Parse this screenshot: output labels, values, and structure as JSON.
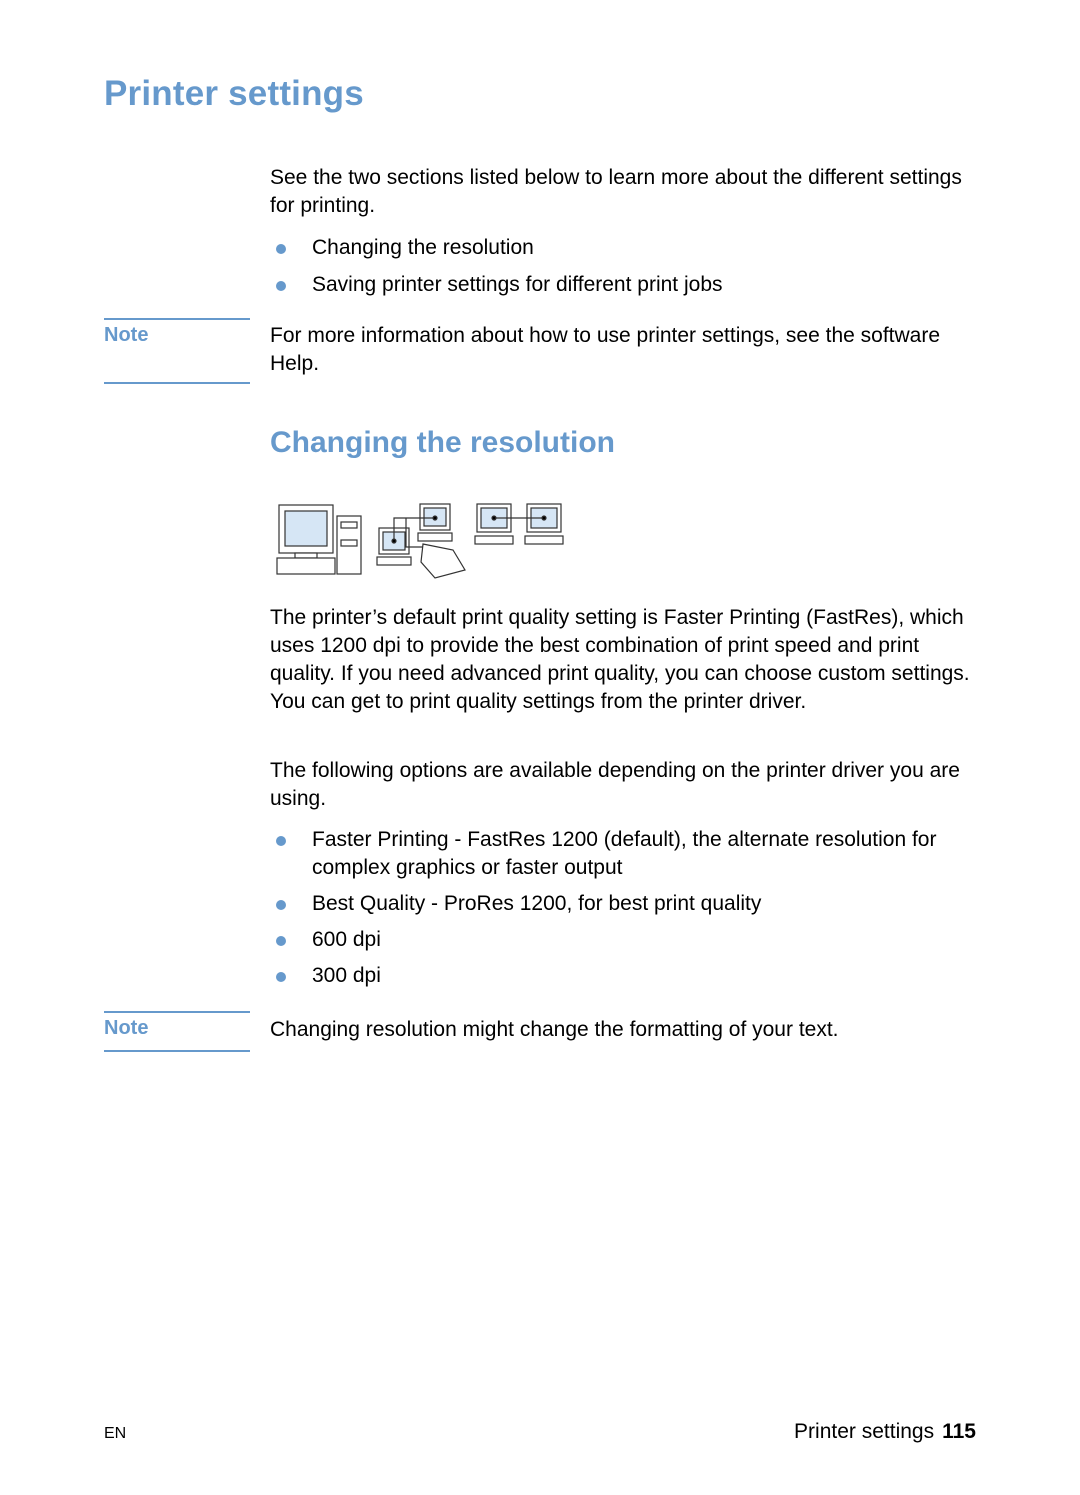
{
  "page_title": "Printer settings",
  "intro": {
    "text": "See the two sections listed below to learn more about the different settings for printing.",
    "bullets": [
      "Changing the resolution",
      "Saving printer settings for different print jobs"
    ]
  },
  "note1": {
    "label": "Note",
    "text": "For more information about how to use printer settings, see the software Help."
  },
  "section": {
    "title": "Changing the resolution",
    "illustration": "computer-network-printer-illustration",
    "paragraph1": "The printer’s default print quality setting is Faster Printing (FastRes), which uses 1200 dpi to provide the best combination of print speed and print quality. If you need advanced print quality, you can choose custom settings. You can get to print quality settings from the printer driver.",
    "paragraph2": "The following options are available depending on the printer driver you are using.",
    "bullets": [
      "Faster Printing - FastRes 1200 (default), the alternate resolution for complex graphics or faster output",
      "Best Quality - ProRes 1200, for best print quality",
      "600 dpi",
      "300 dpi"
    ]
  },
  "note2": {
    "label": "Note",
    "text": "Changing resolution might change the formatting of your text."
  },
  "footer": {
    "language": "EN",
    "section_name": "Printer settings",
    "page_number": "115"
  },
  "colors": {
    "accent": "#6699cc",
    "screen": "#d6e6f5"
  }
}
